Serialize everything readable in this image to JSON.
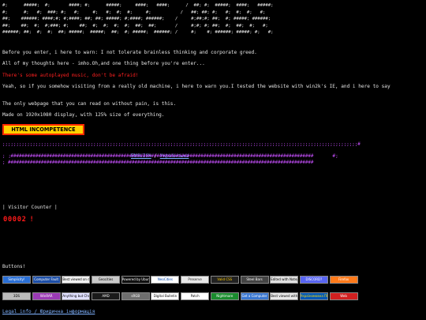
{
  "ascii_logo": "#;      #####;  #;       ####; #;      #####;     ####;   ####;      /  ##; #;  #####;  ####;   #####;\n#;      #;   #;  ###; #;   #;     #;   #;  #;  #;     #;           /   ##; ##; #;   #;  #;  #;   #;\n##;    ######; ####;#; #;####; ##; ##; #####; #;####; ######;    /     #;##;#; ##;  #; #####; ######;\n##;    ##;  #;  #;###; #;    ##;  #;  #;  #;  #;  ##;  ##;       /     #;#; #; ##;  #;  ##;  #;   #;\n######; ##;  #;  #;  ##; #####;  #####;  ##;  #; #####;  ######; /     #;    #; ######; #####; #;   #;",
  "paragraphs": [
    "Before you enter, i here to warn: I not tolerate brainless thinking and corporate greed.",
    "All of my thoughts here - imho.Oh,and one thing before you're enter...",
    "Yeah, so if you somehow visiting from a really old machine, i here to warn you.I tested the website with win2k's IE, and i here to say",
    "The only webpage that you can read on without pain, is this.",
    "Made on 1920x1080 display, with 125% size of everything."
  ],
  "warning_text": "There's some autoplayed music, don't be afraid!",
  "banner_label": "HTML INCOMPETENCE AHEAD",
  "hash_top": ";;;;;;;;;;;;;;;;;;;;;;;;;;;;;;;;;;;;;;;;;;;;;;;;;;;;;;;;;;;;;;;;;;;;;;;;;;;;;;;;;;;;;;;;;;;;;;;;;;;;;;;;;;;;;;;;;;;;;;;;;;;;;;;;;#",
  "nav": {
    "left_edge": ";",
    "english": "ENGLISH",
    "separator": "/",
    "ukrainian": "Українська",
    "right_edge": "#;"
  },
  "hash_bottom_1": ";  ##############################################################################################################",
  "hash_bottom_2": "; ###############################################################################################################",
  "visitor_counter_label": "| Visitor Counter |",
  "visitor_counter_value": "00002",
  "buttons_label": "Buttons!",
  "buttons_row1": [
    {
      "label": "Simplicity!",
      "bg": "#2a6fd6",
      "fg": "#ffffff"
    },
    {
      "label": "Computer Fault",
      "bg": "#1d4fa8",
      "fg": "#ffffff"
    },
    {
      "label": "Best viewed on desktop",
      "bg": "#f0f0f0",
      "fg": "#000000"
    },
    {
      "label": "Geocities",
      "bg": "#c9c9c9",
      "fg": "#000000"
    },
    {
      "label": "Powered by Ubuntu",
      "bg": "#101010",
      "fg": "#ffffff"
    },
    {
      "label": "NeoCities",
      "bg": "#ffffff",
      "fg": "#0044aa"
    },
    {
      "label": "Preserve",
      "bg": "#e8e8e8",
      "fg": "#222222"
    },
    {
      "label": "Valid CSS",
      "bg": "#222222",
      "fg": "#ffcc00"
    },
    {
      "label": "Steel Bars",
      "bg": "#444444",
      "fg": "#ffffff"
    },
    {
      "label": "Edited with Notepad",
      "bg": "#e0e0e0",
      "fg": "#000000"
    },
    {
      "label": "DISCORD?",
      "bg": "#5865f2",
      "fg": "#ffffff"
    },
    {
      "label": "Firefox",
      "bg": "#ff7a1a",
      "fg": "#ffffff"
    }
  ],
  "buttons_row2": [
    {
      "label": "3DS",
      "bg": "#bbbbbb",
      "fg": "#000000"
    },
    {
      "label": "WinRAR",
      "bg": "#9b3ab5",
      "fg": "#ffffff"
    },
    {
      "label": "Anything but Chrome",
      "bg": "#e0e0ff",
      "fg": "#000000"
    },
    {
      "label": "AMD",
      "bg": "#1a1a1a",
      "fg": "#ffffff"
    },
    {
      "label": "sRGB",
      "bg": "#6e6e6e",
      "fg": "#ffffff"
    },
    {
      "label": "Digital Bulletin",
      "bg": "#ffffff",
      "fg": "#000000"
    },
    {
      "label": "Patch",
      "bg": "#ffffff",
      "fg": "#000000"
    },
    {
      "label": "Nightmare",
      "bg": "#1a8c2e",
      "fg": "#ffffff"
    },
    {
      "label": "Get a Computer",
      "bg": "#3a77d0",
      "fg": "#ffffff"
    },
    {
      "label": "Best viewed with Open Eyes",
      "bg": "#e8e8e8",
      "fg": "#000000"
    },
    {
      "label": "Україномовна ПРЕСА",
      "bg": "#0057b7",
      "fg": "#ffd700"
    },
    {
      "label": "Web",
      "bg": "#d02020",
      "fg": "#ffffff"
    }
  ],
  "footer_link": "Legal info / Юридична інформація"
}
